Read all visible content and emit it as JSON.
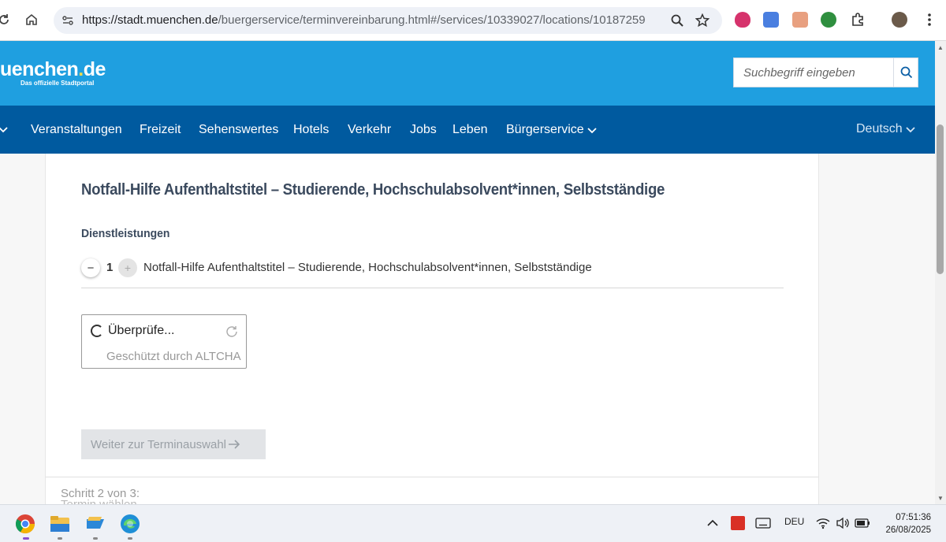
{
  "browser": {
    "url_host": "https://stadt.muenchen.de",
    "url_path": "/buergerservice/terminvereinbarung.html#/services/10339027/locations/10187259"
  },
  "header": {
    "logo_text": "uenchen",
    "logo_dot": ".",
    "logo_suffix": "de",
    "tagline": "Das offizielle Stadtportal",
    "search_placeholder": "Suchbegriff eingeben"
  },
  "nav": {
    "items": [
      "Veranstaltungen",
      "Freizeit",
      "Sehenswertes",
      "Hotels",
      "Verkehr",
      "Jobs",
      "Leben",
      "Bürgerservice"
    ],
    "language": "Deutsch"
  },
  "main": {
    "title": "Notfall-Hilfe Aufenthaltstitel – Studierende, Hochschulabsolvent*innen, Selbstständige",
    "section_title": "Dienstleistungen",
    "service": {
      "quantity": "1",
      "minus_label": "−",
      "plus_label": "+",
      "name": "Notfall-Hilfe Aufenthaltstitel – Studierende, Hochschulabsolvent*innen, Selbstständige"
    },
    "captcha": {
      "status": "Überprüfe...",
      "protected_by": "Geschützt durch ALTCHA"
    },
    "next_button": "Weiter zur Terminauswahl",
    "step_text": "Schritt 2 von 3:",
    "step_subtitle": "Termin wählen"
  },
  "taskbar": {
    "language": "DEU",
    "time": "07:51:36",
    "date": "26/08/2025"
  },
  "colors": {
    "header_blue": "#1f9fe0",
    "nav_blue": "#005a9f",
    "title_color": "#3b4a5e"
  }
}
